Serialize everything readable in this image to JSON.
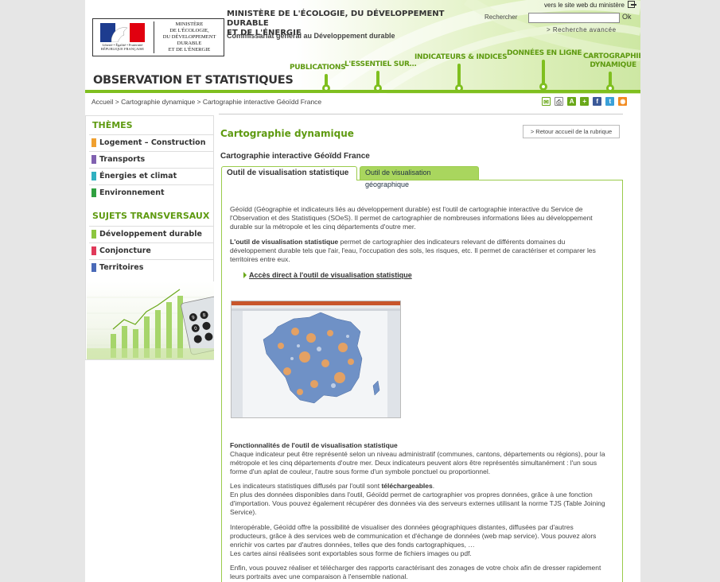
{
  "header": {
    "logo": {
      "republic_text": "Liberté • Égalité • Fraternité\nRÉPUBLIQUE FRANÇAISE",
      "ministry_text": "MINISTÈRE\nDE L'ÉCOLOGIE,\nDU DÉVELOPPEMENT\nDURABLE\nET DE L'ÉNERGIE"
    },
    "ministry_title": "MINISTÈRE DE L'ÉCOLOGIE, DU DÉVELOPPEMENT DURABLE\nET DE L'ÉNERGIE",
    "department": "Commissariat général au Développement durable",
    "site_title": "OBSERVATION ET STATISTIQUES",
    "ministry_link": "vers le site web du ministère",
    "search": {
      "label": "Rechercher",
      "value": "",
      "ok": "Ok",
      "advanced": "> Recherche avancée"
    },
    "nav": [
      {
        "label": "PUBLICATIONS"
      },
      {
        "label": "L'ESSENTIEL SUR…"
      },
      {
        "label": "INDICATEURS & INDICES"
      },
      {
        "label": "DONNÉES EN LIGNE"
      },
      {
        "label": "CARTOGRAPHIE\nDYNAMIQUE"
      }
    ],
    "accent_color": "#7fbf1f"
  },
  "breadcrumb": "Accueil > Cartographie dynamique > Cartographie interactive Géoïdd France",
  "share_icons": [
    "email-icon",
    "print-icon",
    "text-size-icon",
    "share-icon",
    "facebook-icon",
    "twitter-icon",
    "rss-icon"
  ],
  "sidebar": {
    "themes_heading": "THÈMES",
    "themes": [
      {
        "label": "Logement – Construction",
        "color": "#f0a030"
      },
      {
        "label": "Transports",
        "color": "#8060b0"
      },
      {
        "label": "Énergies et climat",
        "color": "#30b0c0"
      },
      {
        "label": "Environnement",
        "color": "#30a040"
      }
    ],
    "transversal_heading": "SUJETS TRANSVERSAUX",
    "transversal": [
      {
        "label": "Développement durable",
        "color": "#8cc63f"
      },
      {
        "label": "Conjoncture",
        "color": "#e03a5a"
      },
      {
        "label": "Territoires",
        "color": "#4a6ab8"
      }
    ]
  },
  "main": {
    "title": "Cartographie dynamique",
    "back_button": "> Retour accueil de la rubrique",
    "subtitle": "Cartographie interactive Géoïdd France",
    "tabs": [
      {
        "label": "Outil de visualisation statistique",
        "active": true
      },
      {
        "label": "Outil de visualisation géographique",
        "active": false
      }
    ],
    "intro": "Géoïdd (Géographie et indicateurs liés au développement durable) est l'outil de cartographie interactive du Service de l'Observation et des Statistiques (SOeS). Il permet de cartographier de nombreuses informations liées au développement durable sur la métropole et les cinq départements d'outre mer.",
    "tool_strong": "L'outil de visualisation statistique",
    "tool_rest": " permet de cartographier des indicateurs relevant de différents domaines du développement durable tels que l'air, l'eau, l'occupation des sols, les risques, etc. Il permet de caractériser et comparer les territoires entre eux.",
    "access_link": "Accès direct à l'outil de visualisation statistique",
    "features_heading": "Fonctionnalités de l'outil de visualisation statistique",
    "features_text": "Chaque indicateur peut être représenté selon un niveau administratif (communes, cantons, départements ou régions), pour la métropole et les cinq départements d'outre mer. Deux indicateurs peuvent alors être représentés simultanément : l'un sous forme d'un aplat de couleur, l'autre sous forme d'un symbole ponctuel ou proportionnel.",
    "download_pre": "Les indicateurs statistiques diffusés par l'outil sont ",
    "download_strong": "téléchargeables",
    "download_post": ".",
    "download_more": "En plus des données disponibles dans l'outil, Géoïdd permet de cartographier vos propres données, grâce à une fonction d'importation. Vous pouvez également récupérer des données via des serveurs externes utilisant la norme TJS (Table Joining Service).",
    "interop": "Interopérable, Géoïdd offre la possibilité de visualiser des données géographiques distantes, diffusées par d'autres producteurs, grâce à des services web de communication et d'échange de données (web map service). Vous pouvez alors enrichir vos cartes par d'autres données, telles que des fonds cartographiques, …",
    "export": "Les cartes ainsi réalisées sont exportables sous forme de fichiers images ou pdf.",
    "reports": "Enfin, vous pouvez réaliser et télécharger des rapports caractérisant des zonages de votre choix afin de dresser rapidement leurs portraits avec une comparaison à l'ensemble national."
  }
}
